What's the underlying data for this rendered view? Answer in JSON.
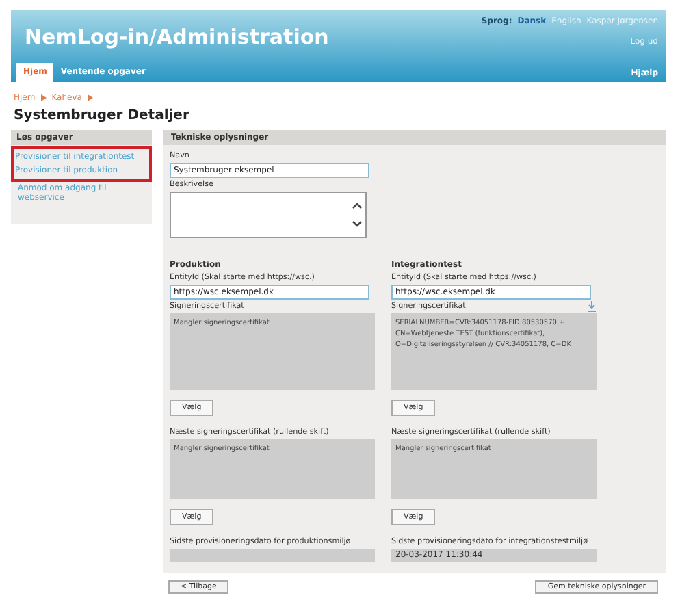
{
  "header": {
    "title": "NemLog-in/Administration",
    "language_label": "Sprog:",
    "languages": [
      {
        "label": "Dansk",
        "selected": true
      },
      {
        "label": "English",
        "selected": false
      }
    ],
    "user": "Kaspar Jørgensen",
    "logout": "Log ud",
    "help": "Hjælp"
  },
  "tabs": [
    {
      "label": "Hjem",
      "selected": true
    },
    {
      "label": "Ventende opgaver",
      "selected": false
    }
  ],
  "breadcrumb": [
    "Hjem",
    "Kaheva"
  ],
  "page_title": "Systembruger Detaljer",
  "sidebar": {
    "title": "Løs opgaver",
    "items": [
      {
        "label": "Provisioner til integrationtest",
        "highlighted": true
      },
      {
        "label": "Provisioner til produktion",
        "highlighted": true
      },
      {
        "label": "Anmod om adgang til webservice",
        "highlighted": false
      }
    ]
  },
  "panel": {
    "title": "Tekniske oplysninger",
    "name_label": "Navn",
    "name_value": "Systembruger eksempel",
    "description_label": "Beskrivelse",
    "columns": [
      {
        "heading": "Produktion",
        "entity_label": "EntityId (Skal starte med https://wsc.)",
        "entity_value": "https://wsc.eksempel.dk",
        "cert_label": "Signeringscertifikat",
        "cert_download": false,
        "cert_text": "Mangler signeringscertifikat",
        "choose_button": "Vælg",
        "next_label": "Næste signeringscertifikat (rullende skift)",
        "next_text": "Mangler signeringscertifikat",
        "next_button": "Vælg",
        "date_label": "Sidste provisioneringsdato for produktionsmiljø"
      },
      {
        "heading": "Integrationtest",
        "entity_label": "EntityId (Skal starte med https://wsc.)",
        "entity_value": "https://wsc.eksempel.dk",
        "cert_label": "Signeringscertifikat",
        "cert_download": true,
        "cert_text": "SERIALNUMBER=CVR:34051178-FID:80530570 + CN=Webtjeneste TEST (funktionscertifikat), O=Digitaliseringsstyrelsen // CVR:34051178, C=DK",
        "choose_button": "Vælg",
        "next_label": "Næste signeringscertifikat (rullende skift)",
        "next_text": "Mangler signeringscertifikat",
        "next_button": "Vælg",
        "date_label": "Sidste provisioneringsdato for integrationstestmiljø",
        "date_value": "20-03-2017 11:30:44"
      }
    ]
  },
  "buttons": {
    "back": "< Tilbage",
    "save": "Gem tekniske oplysninger"
  }
}
